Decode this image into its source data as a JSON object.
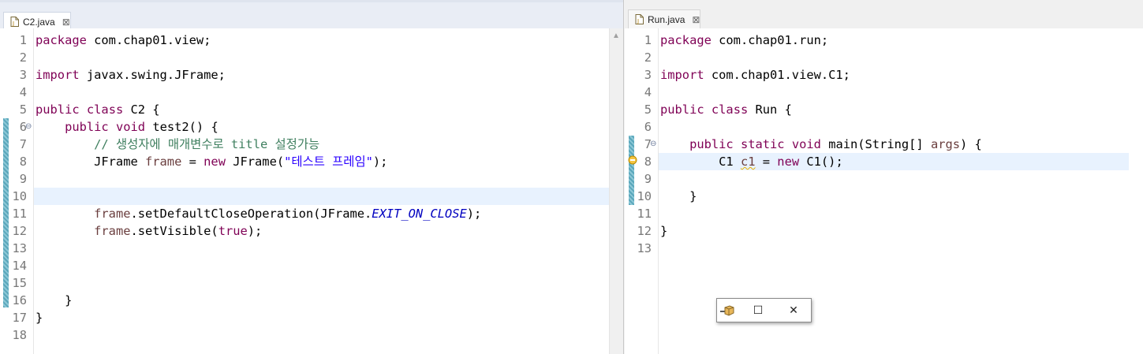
{
  "left_editor": {
    "tab_label": "C2.java",
    "close_glyph": "⊠",
    "lines": [
      {
        "n": "1",
        "parts": [
          {
            "t": "package",
            "c": "kw"
          },
          {
            "t": " com.chap01.view;"
          }
        ]
      },
      {
        "n": "2",
        "parts": []
      },
      {
        "n": "3",
        "parts": [
          {
            "t": "import",
            "c": "kw"
          },
          {
            "t": " javax.swing.JFrame;"
          }
        ]
      },
      {
        "n": "4",
        "parts": []
      },
      {
        "n": "5",
        "parts": [
          {
            "t": "public",
            "c": "kw"
          },
          {
            "t": " "
          },
          {
            "t": "class",
            "c": "kw"
          },
          {
            "t": " C2 {"
          }
        ]
      },
      {
        "n": "6",
        "parts": [
          {
            "t": "    "
          },
          {
            "t": "public",
            "c": "kw"
          },
          {
            "t": " "
          },
          {
            "t": "void",
            "c": "kw"
          },
          {
            "t": " test2() {"
          }
        ],
        "fold": "⊖"
      },
      {
        "n": "7",
        "parts": [
          {
            "t": "        "
          },
          {
            "t": "// 생성자에 매개변수로 title 설정가능",
            "c": "cm"
          }
        ]
      },
      {
        "n": "8",
        "parts": [
          {
            "t": "        JFrame "
          },
          {
            "t": "frame",
            "c": "lv"
          },
          {
            "t": " = "
          },
          {
            "t": "new",
            "c": "kw"
          },
          {
            "t": " JFrame("
          },
          {
            "t": "\"테스트 프레임\"",
            "c": "str"
          },
          {
            "t": ");"
          }
        ]
      },
      {
        "n": "9",
        "parts": []
      },
      {
        "n": "10",
        "parts": [],
        "current": true
      },
      {
        "n": "11",
        "parts": [
          {
            "t": "        "
          },
          {
            "t": "frame",
            "c": "lv"
          },
          {
            "t": ".setDefaultCloseOperation(JFrame."
          },
          {
            "t": "EXIT_ON_CLOSE",
            "c": "stat"
          },
          {
            "t": ");"
          }
        ]
      },
      {
        "n": "12",
        "parts": [
          {
            "t": "        "
          },
          {
            "t": "frame",
            "c": "lv"
          },
          {
            "t": ".setVisible("
          },
          {
            "t": "true",
            "c": "kw"
          },
          {
            "t": ");"
          }
        ]
      },
      {
        "n": "13",
        "parts": []
      },
      {
        "n": "14",
        "parts": []
      },
      {
        "n": "15",
        "parts": []
      },
      {
        "n": "16",
        "parts": [
          {
            "t": "    }"
          }
        ]
      },
      {
        "n": "17",
        "parts": [
          {
            "t": "}"
          }
        ]
      },
      {
        "n": "18",
        "parts": []
      }
    ]
  },
  "right_editor": {
    "tab_label": "Run.java",
    "close_glyph": "⊠",
    "lines": [
      {
        "n": "1",
        "parts": [
          {
            "t": "package",
            "c": "kw"
          },
          {
            "t": " com.chap01.run;"
          }
        ]
      },
      {
        "n": "2",
        "parts": []
      },
      {
        "n": "3",
        "parts": [
          {
            "t": "import",
            "c": "kw"
          },
          {
            "t": " com.chap01.view.C1;"
          }
        ]
      },
      {
        "n": "4",
        "parts": []
      },
      {
        "n": "5",
        "parts": [
          {
            "t": "public",
            "c": "kw"
          },
          {
            "t": " "
          },
          {
            "t": "class",
            "c": "kw"
          },
          {
            "t": " Run {"
          }
        ]
      },
      {
        "n": "6",
        "parts": []
      },
      {
        "n": "7",
        "parts": [
          {
            "t": "    "
          },
          {
            "t": "public",
            "c": "kw"
          },
          {
            "t": " "
          },
          {
            "t": "static",
            "c": "kw"
          },
          {
            "t": " "
          },
          {
            "t": "void",
            "c": "kw"
          },
          {
            "t": " main(String[] "
          },
          {
            "t": "args",
            "c": "lv"
          },
          {
            "t": ") {"
          }
        ],
        "fold": "⊖"
      },
      {
        "n": "8",
        "parts": [
          {
            "t": "        C1 "
          },
          {
            "t": "c1",
            "c": "lv warn"
          },
          {
            "t": " = "
          },
          {
            "t": "new",
            "c": "kw"
          },
          {
            "t": " C1();"
          }
        ],
        "current": true
      },
      {
        "n": "9",
        "parts": []
      },
      {
        "n": "10",
        "parts": [
          {
            "t": "    }"
          }
        ]
      },
      {
        "n": "11",
        "parts": []
      },
      {
        "n": "12",
        "parts": [
          {
            "t": "}"
          }
        ]
      },
      {
        "n": "13",
        "parts": []
      }
    ]
  },
  "floating_window": {
    "minimize_glyph": "—",
    "maximize_glyph": "☐",
    "close_glyph": "✕"
  },
  "colors": {
    "keyword": "#7f0055",
    "string": "#2a00ff",
    "comment": "#3f7f5f",
    "static_field": "#0000c0",
    "local_variable": "#6a3e3e",
    "current_line": "#e8f2fe"
  }
}
